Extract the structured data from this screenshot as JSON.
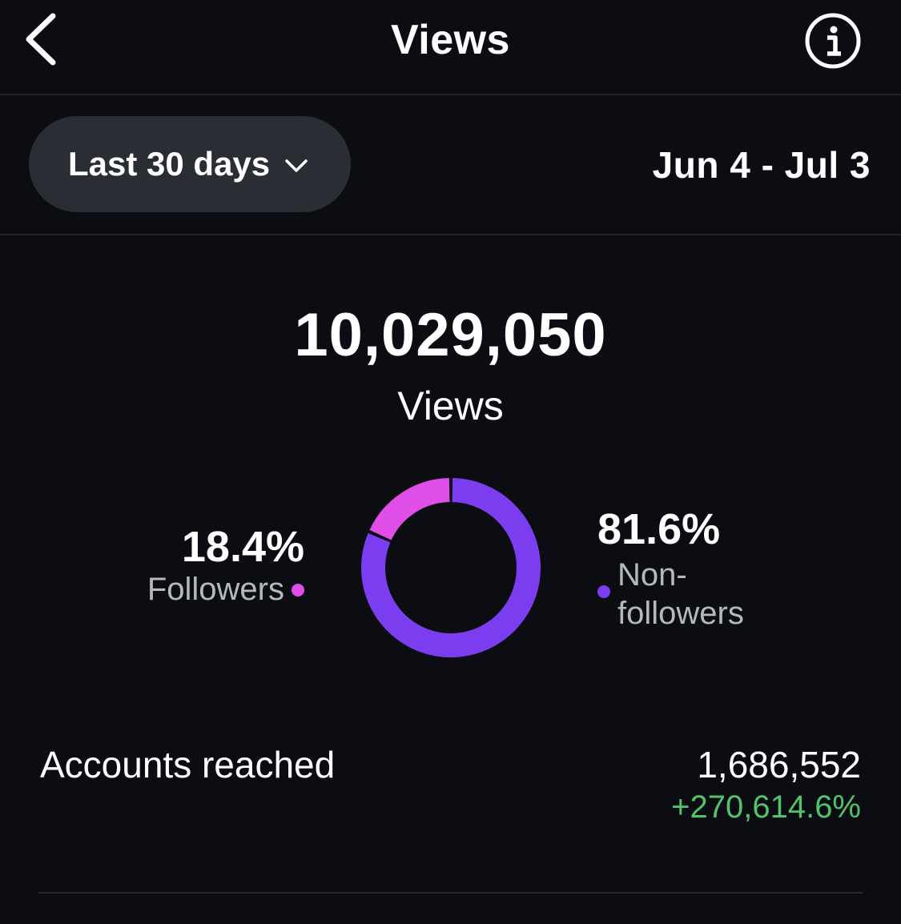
{
  "header": {
    "title": "Views",
    "back_icon": "chevron-left-icon",
    "info_icon": "info-icon"
  },
  "filter": {
    "selected_range": "Last 30 days",
    "date_range": "Jun 4 - Jul 3"
  },
  "summary": {
    "total": "10,029,050",
    "label": "Views"
  },
  "breakdown": {
    "followers": {
      "percent": "18.4%",
      "label": "Followers",
      "color": "#e04ee8"
    },
    "non_followers": {
      "percent": "81.6%",
      "label": "Non-followers",
      "label_line1": "Non-",
      "label_line2": "followers",
      "color": "#7a3ef0"
    }
  },
  "chart_data": {
    "type": "pie",
    "categories": [
      "Followers",
      "Non-followers"
    ],
    "values": [
      18.4,
      81.6
    ],
    "colors": [
      "#e04ee8",
      "#7a3ef0"
    ],
    "style": "donut"
  },
  "reach": {
    "label": "Accounts reached",
    "value": "1,686,552",
    "change": "+270,614.6%",
    "change_color": "#52c26b"
  }
}
